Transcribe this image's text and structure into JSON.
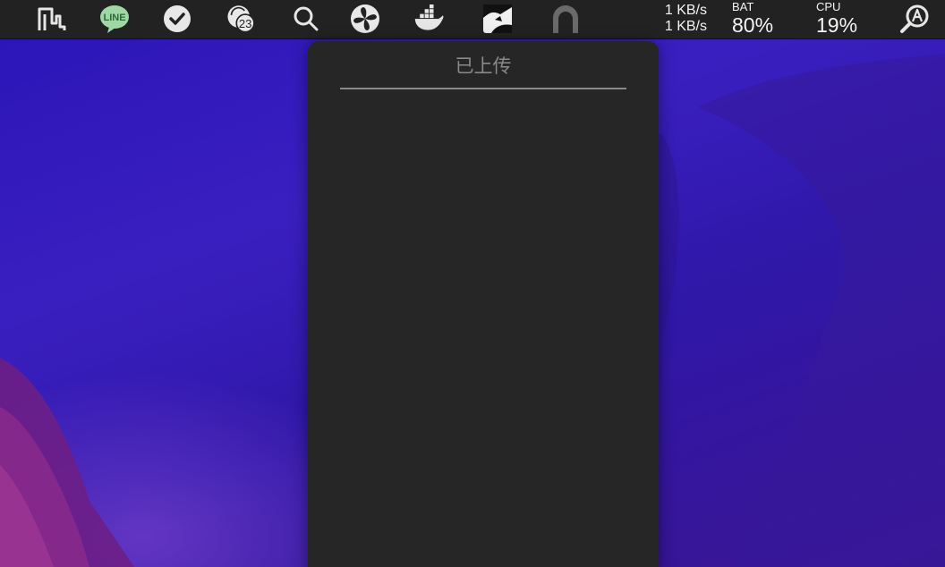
{
  "menubar": {
    "icons": [
      {
        "name": "stats-monitor-icon"
      },
      {
        "name": "line-app-icon",
        "label": "LINE"
      },
      {
        "name": "task-check-icon"
      },
      {
        "name": "calendar-icon",
        "badge": "23"
      },
      {
        "name": "search-icon"
      },
      {
        "name": "pinwheel-icon"
      },
      {
        "name": "docker-icon"
      },
      {
        "name": "picgo-upload-icon"
      },
      {
        "name": "tunnel-arch-icon"
      }
    ],
    "network": {
      "upload": "1 KB/s",
      "download": "1 KB/s"
    },
    "battery": {
      "label": "BAT",
      "value": "80%"
    },
    "cpu": {
      "label": "CPU",
      "value": "19%"
    },
    "right_icon": {
      "name": "input-source-icon"
    }
  },
  "panel": {
    "tab_label": "已上传"
  }
}
